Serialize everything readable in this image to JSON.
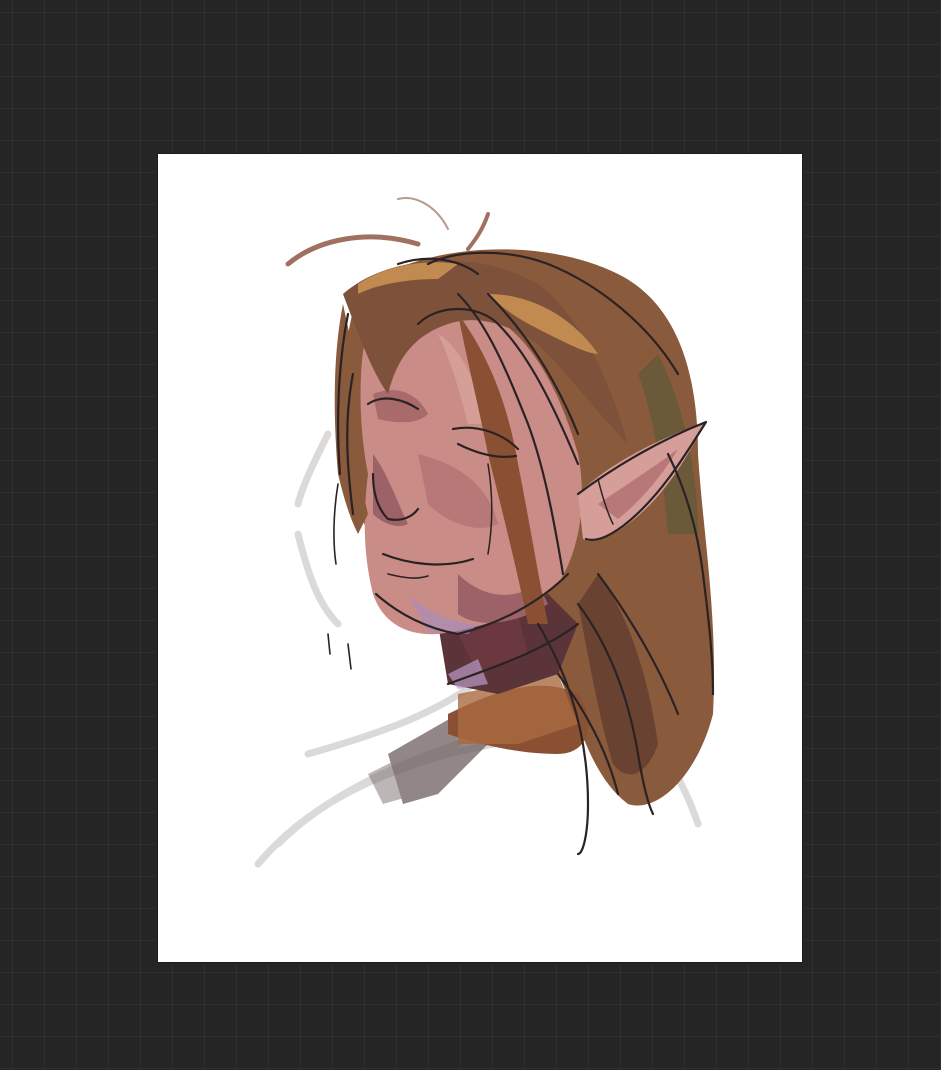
{
  "app": {
    "workspace_background": "#252525",
    "grid_color": "#2f2f2f",
    "canvas_background": "#ffffff"
  },
  "artwork": {
    "subject": "painted-sketch-portrait",
    "palette": {
      "hair": "#8a5a3c",
      "hair_highlight": "#c08a50",
      "hair_shadow": "#5e3a2a",
      "skin": "#c98c86",
      "skin_shadow": "#9c6268",
      "neck_shadow": "#5a3438",
      "line": "#2a2224",
      "sketch_gray": "#d9d6d6",
      "accent_purple": "#a98bb8"
    }
  }
}
